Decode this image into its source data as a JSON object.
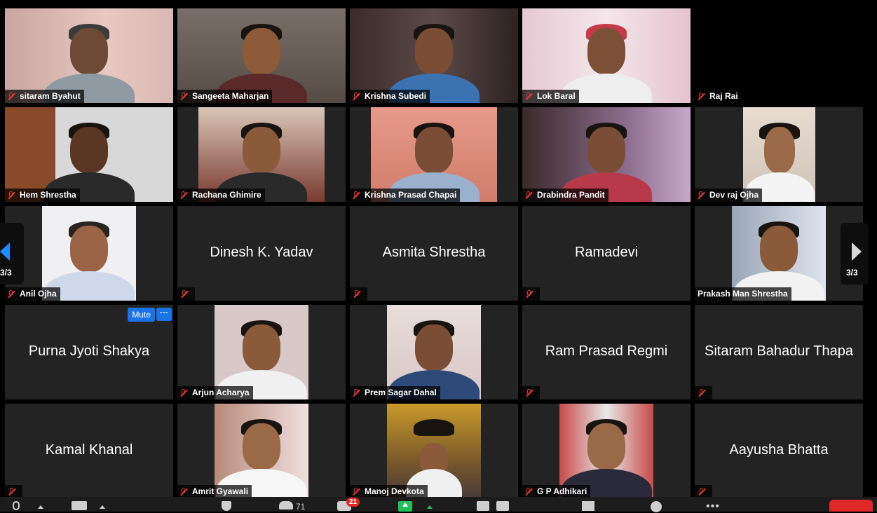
{
  "participants": [
    {
      "name": "sitaram Byahut",
      "video": true
    },
    {
      "name": "Sangeeta Maharjan",
      "video": true
    },
    {
      "name": "Krishna Subedi",
      "video": true
    },
    {
      "name": "Lok Baral",
      "video": true
    },
    {
      "name": "Raj Rai",
      "video": false
    },
    {
      "name": "Hem Shrestha",
      "video": true
    },
    {
      "name": "Rachana Ghimire",
      "video": true
    },
    {
      "name": "Krishna Prasad Chapai",
      "video": true
    },
    {
      "name": "Drabindra Pandit",
      "video": true
    },
    {
      "name": "Dev raj Ojha",
      "video": true
    },
    {
      "name": "Anil Ojha",
      "video": true
    },
    {
      "name": "Dinesh K. Yadav",
      "video": false
    },
    {
      "name": "Asmita Shrestha",
      "video": false
    },
    {
      "name": "Ramadevi",
      "video": false
    },
    {
      "name": "Prakash Man Shrestha",
      "video": true
    },
    {
      "name": "Purna Jyoti Shakya",
      "video": false
    },
    {
      "name": "Arjun Acharya",
      "video": true
    },
    {
      "name": "Prem Sagar Dahal",
      "video": true
    },
    {
      "name": "Ram Prasad Regmi",
      "video": false
    },
    {
      "name": "Sitaram Bahadur Thapa",
      "video": false
    },
    {
      "name": "Kamal Khanal",
      "video": false
    },
    {
      "name": "Amrit Gyawali",
      "video": true
    },
    {
      "name": "Manoj Devkota",
      "video": true
    },
    {
      "name": "G P Adhikari",
      "video": true
    },
    {
      "name": "Aayusha Bhatta",
      "video": false
    }
  ],
  "hover_controls": {
    "mute_label": "Mute",
    "more_label": "···"
  },
  "pagination": {
    "left_page": "3/3",
    "right_page": "3/3"
  },
  "toolbar": {
    "participants_count": "71",
    "chat_badge": "21",
    "more_label": "•••"
  },
  "colors": {
    "accent_blue": "#1a73e8",
    "muted_red": "#e53935",
    "share_green": "#21c05b",
    "end_red": "#e02828"
  }
}
